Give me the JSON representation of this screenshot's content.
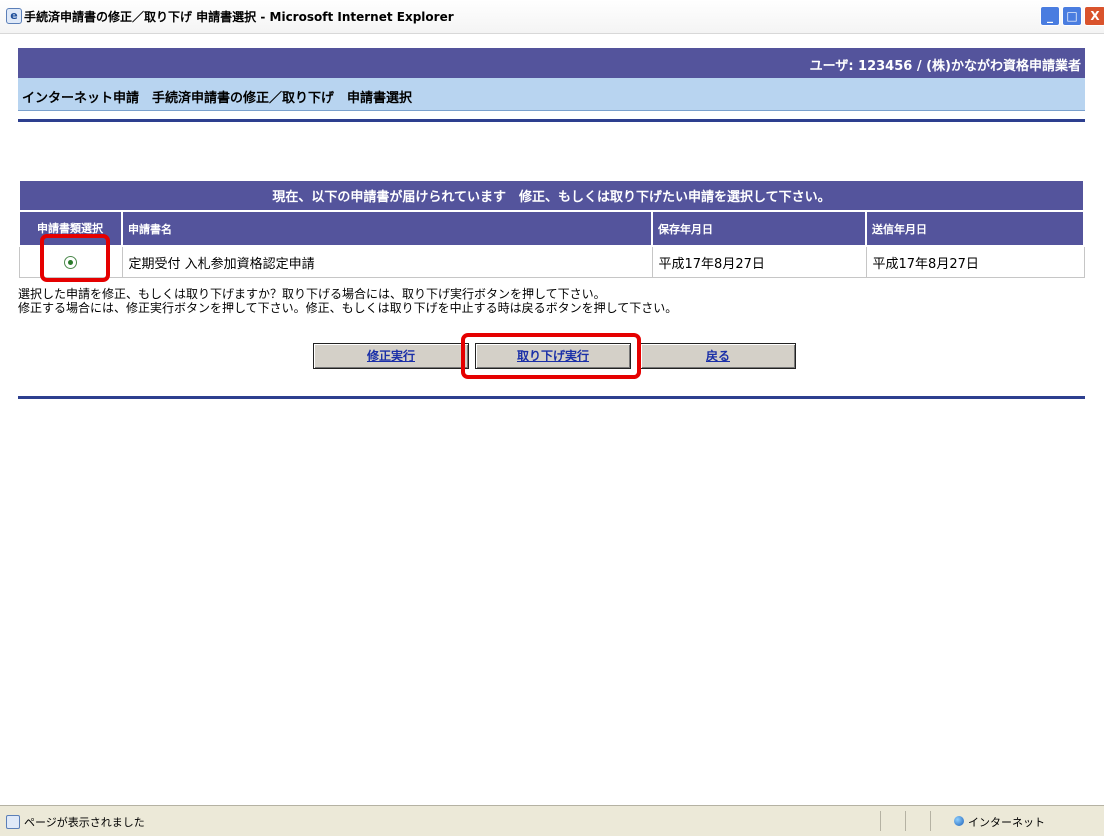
{
  "window": {
    "title": "手続済申請書の修正／取り下げ 申請書選択 - Microsoft Internet Explorer",
    "minimize": "_",
    "maximize": "□",
    "close": "X"
  },
  "header": {
    "user_info": "ユーザ: 123456 / (株)かながわ資格申請業者",
    "page_title": "インターネット申請　手続済申請書の修正／取り下げ　申請書選択"
  },
  "table": {
    "caption": "現在、以下の申請書が届けられています　修正、もしくは取り下げたい申請を選択して下さい。",
    "columns": [
      "申請書類選択",
      "申請書名",
      "保存年月日",
      "送信年月日"
    ],
    "rows": [
      {
        "selected": true,
        "name": "定期受付 入札参加資格認定申請",
        "saved_date": "平成17年8月27日",
        "sent_date": "平成17年8月27日"
      }
    ]
  },
  "instructions": {
    "line1": "選択した申請を修正、もしくは取り下げますか？取り下げる場合には、取り下げ実行ボタンを押して下さい。",
    "line2": "修正する場合には、修正実行ボタンを押して下さい。修正、もしくは取り下げを中止する時は戻るボタンを押して下さい。"
  },
  "buttons": {
    "modify": "修正実行",
    "withdraw": "取り下げ実行",
    "back": "戻る"
  },
  "statusbar": {
    "text": "ページが表示されました",
    "zone": "インターネット"
  },
  "colors": {
    "header_bg": "#54549c",
    "title_band": "#b8d4f0",
    "highlight": "#e50000",
    "link": "#1a2fa8"
  }
}
